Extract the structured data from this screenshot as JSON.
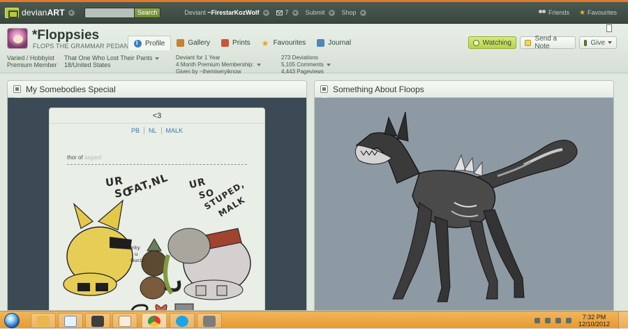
{
  "topbar": {
    "logo": {
      "prefix": "devian",
      "bold": "ART"
    },
    "search": {
      "placeholder": "",
      "button": "Search"
    },
    "user": {
      "prefix": "Deviant",
      "name": "~FirestarKozWolf"
    },
    "messages_count": "7",
    "submit": "Submit",
    "shop": "Shop",
    "friends": "Friends",
    "favourites": "Favourites"
  },
  "profile": {
    "username": "*Floppsies",
    "tagline": "FLOPS THE GRAMMAR PEDANT",
    "tabs": [
      {
        "label": "Profile",
        "icon": "profile-icon",
        "active": true
      },
      {
        "label": "Gallery",
        "icon": "gallery-icon"
      },
      {
        "label": "Prints",
        "icon": "prints-icon"
      },
      {
        "label": "Favourites",
        "icon": "star-icon"
      },
      {
        "label": "Journal",
        "icon": "journal-icon"
      }
    ],
    "buttons": {
      "watching": "Watching",
      "note": "Send a Note",
      "give": "Give"
    },
    "details": {
      "type": "Varied / Hobbyist",
      "membership": "Premium Member",
      "bio": "That One Who Lost Their Pants",
      "location": "18/United States",
      "deviant_for": "Deviant for 1 Year",
      "premium": "4 Month Premium Membership:",
      "given_by": "Given by ~themiseryiknow",
      "deviations": "273 Deviations",
      "comments": "5,105 Comments",
      "pageviews": "4,443 Pageviews"
    }
  },
  "panels": {
    "left": {
      "title": "My Somebodies Special",
      "card": {
        "title": "<3",
        "links": [
          "PB",
          "NL",
          "MALK"
        ],
        "caption_prefix": "thor of",
        "caption_faded": "asgard",
        "scribbles": [
          "UR",
          "SO",
          "FAT,NL",
          "UR",
          "SO",
          "STUPED,",
          "MALK",
          "Jrity",
          "u",
          "Gucio"
        ]
      }
    },
    "right": {
      "title": "Something About Floops"
    }
  },
  "taskbar": {
    "time": "7:32 PM",
    "date": "12/10/2012"
  },
  "colors": {
    "accent": "#e07a2a",
    "topbar": "#3a473f",
    "watching_green": "#b7d24c",
    "link_blue": "#3e7aa8"
  }
}
